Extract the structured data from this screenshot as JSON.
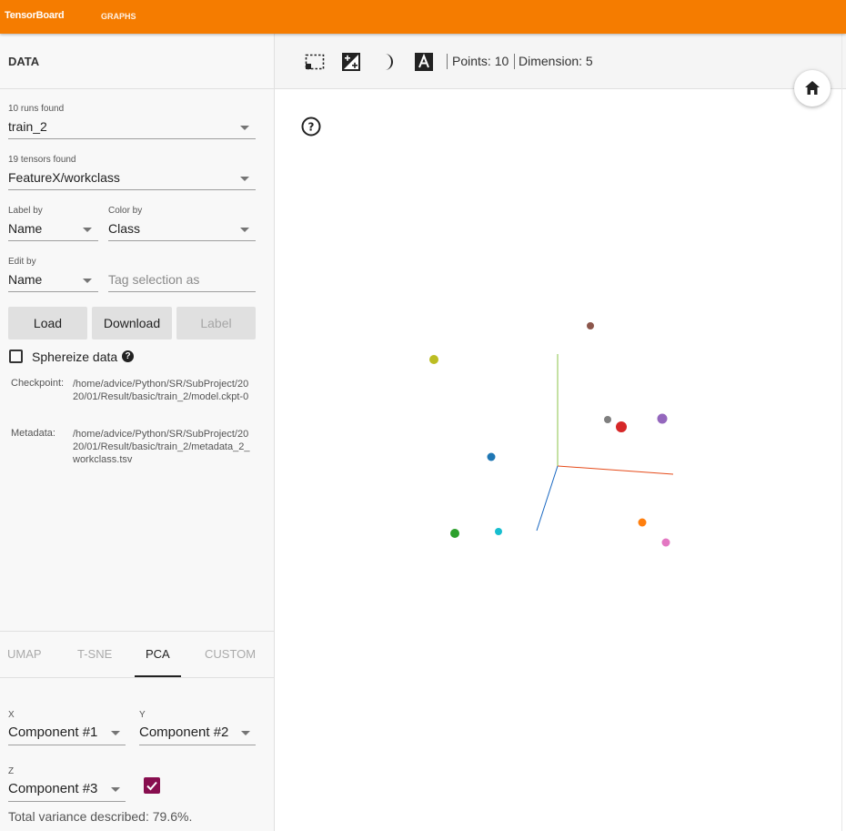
{
  "header": {
    "brand": "TensorBoard",
    "nav_graphs": "GRAPHS"
  },
  "data_panel": {
    "title": "DATA",
    "runs": {
      "label": "10 runs found",
      "value": "train_2"
    },
    "tensors": {
      "label": "19 tensors found",
      "value": "FeatureX/workclass"
    },
    "label_by": {
      "label": "Label by",
      "value": "Name"
    },
    "color_by": {
      "label": "Color by",
      "value": "Class"
    },
    "edit_by": {
      "label": "Edit by",
      "value": "Name"
    },
    "tag_input": {
      "placeholder": "Tag selection as"
    },
    "buttons": {
      "load": "Load",
      "download": "Download",
      "label": "Label"
    },
    "sphereize": {
      "label": "Sphereize data",
      "checked": false
    },
    "checkpoint": {
      "label": "Checkpoint:",
      "value": "/home/advice/Python/SR/SubProject/2020/01/Result/basic/train_2/model.ckpt-0"
    },
    "metadata": {
      "label": "Metadata:",
      "value": "/home/advice/Python/SR/SubProject/2020/01/Result/basic/train_2/metadata_2_workclass.tsv"
    }
  },
  "projection": {
    "tabs": [
      "UMAP",
      "T-SNE",
      "PCA",
      "CUSTOM"
    ],
    "active_tab": "PCA",
    "x": {
      "label": "X",
      "value": "Component #1"
    },
    "y": {
      "label": "Y",
      "value": "Component #2"
    },
    "z": {
      "label": "Z",
      "value": "Component #3",
      "enabled": true
    },
    "variance": "Total variance described: 79.6%."
  },
  "toolbar": {
    "icons": [
      "select-rect-icon",
      "night-mode-icon",
      "moon-icon",
      "label-text-icon"
    ],
    "points": "Points: 10",
    "dimension": "Dimension: 5"
  },
  "colors": {
    "header": "#f57c00",
    "accent": "#880e4f",
    "axis_x": "#e64a19",
    "axis_y": "#8bc34a",
    "axis_z": "#1565c0"
  },
  "scatter_points": [
    {
      "color": "#8c564b"
    },
    {
      "color": "#bcbd22"
    },
    {
      "color": "#7f7f7f"
    },
    {
      "color": "#d62728"
    },
    {
      "color": "#9467bd"
    },
    {
      "color": "#1f77b4"
    },
    {
      "color": "#2ca02c"
    },
    {
      "color": "#17becf"
    },
    {
      "color": "#ff7f0e"
    },
    {
      "color": "#e377c2"
    }
  ]
}
